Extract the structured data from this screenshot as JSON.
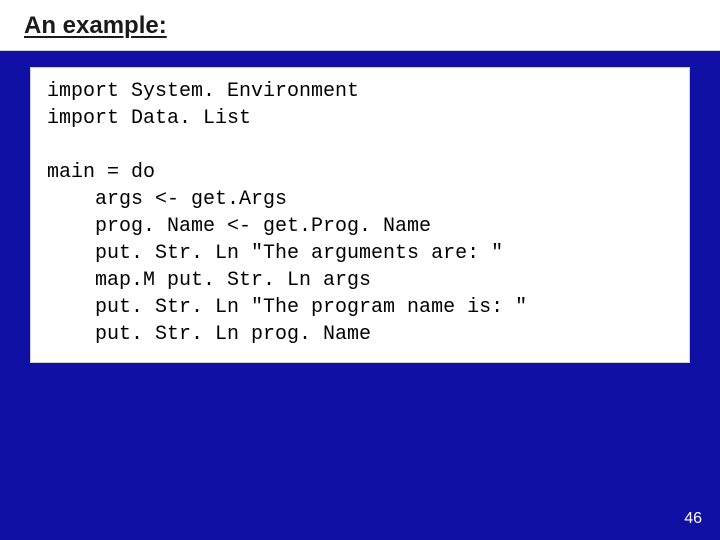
{
  "title": "An example:",
  "code": "import System. Environment\nimport Data. List\n\nmain = do\n    args <- get.Args\n    prog. Name <- get.Prog. Name\n    put. Str. Ln \"The arguments are: \"\n    map.M put. Str. Ln args\n    put. Str. Ln \"The program name is: \"\n    put. Str. Ln prog. Name",
  "page_number": "46"
}
